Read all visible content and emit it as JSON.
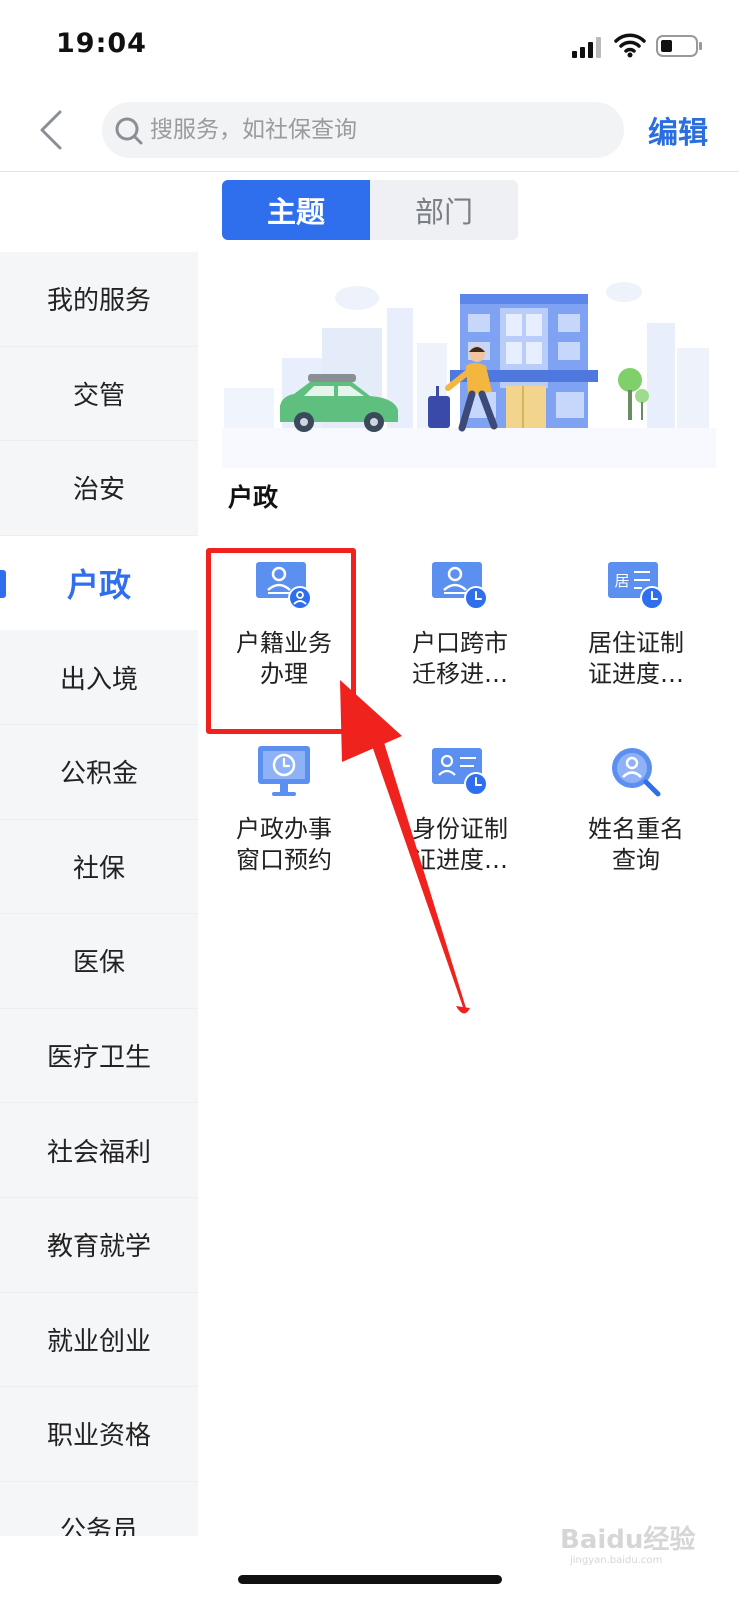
{
  "status_bar": {
    "time": "19:04",
    "icons": [
      "signal-icon",
      "wifi-icon",
      "battery-icon"
    ]
  },
  "header": {
    "back_icon": "chevron-left-icon",
    "search_placeholder": "搜服务，如社保查询",
    "edit_label": "编辑"
  },
  "tabs": [
    {
      "label": "主题",
      "active": true
    },
    {
      "label": "部门",
      "active": false
    }
  ],
  "sidebar": {
    "items": [
      {
        "label": "我的服务",
        "active": false
      },
      {
        "label": "交管",
        "active": false
      },
      {
        "label": "治安",
        "active": false
      },
      {
        "label": "户政",
        "active": true
      },
      {
        "label": "出入境",
        "active": false
      },
      {
        "label": "公积金",
        "active": false
      },
      {
        "label": "社保",
        "active": false
      },
      {
        "label": "医保",
        "active": false
      },
      {
        "label": "医疗卫生",
        "active": false
      },
      {
        "label": "社会福利",
        "active": false
      },
      {
        "label": "教育就学",
        "active": false
      },
      {
        "label": "就业创业",
        "active": false
      },
      {
        "label": "职业资格",
        "active": false
      },
      {
        "label": "公务员",
        "active": false
      }
    ]
  },
  "content": {
    "section_title": "户政",
    "services": [
      {
        "label": "户籍业务\n办理",
        "icon": "id-card-person-icon"
      },
      {
        "label": "户口跨市\n迁移进…",
        "icon": "id-card-clock-icon"
      },
      {
        "label": "居住证制\n证进度…",
        "icon": "residence-card-clock-icon"
      },
      {
        "label": "户政办事\n窗口预约",
        "icon": "monitor-clock-icon"
      },
      {
        "label": "身份证制\n证进度…",
        "icon": "id-card-clock-icon"
      },
      {
        "label": "姓名重名\n查询",
        "icon": "magnifier-person-icon"
      }
    ],
    "residence_card_glyph": "居"
  },
  "colors": {
    "accent": "#2f6fed",
    "edit_text": "#2a6fe0",
    "highlight": "#f0221d",
    "sidebar_bg": "#f5f6f8"
  },
  "watermark": {
    "text": "Baidu经验",
    "subtext": "jingyan.baidu.com"
  }
}
